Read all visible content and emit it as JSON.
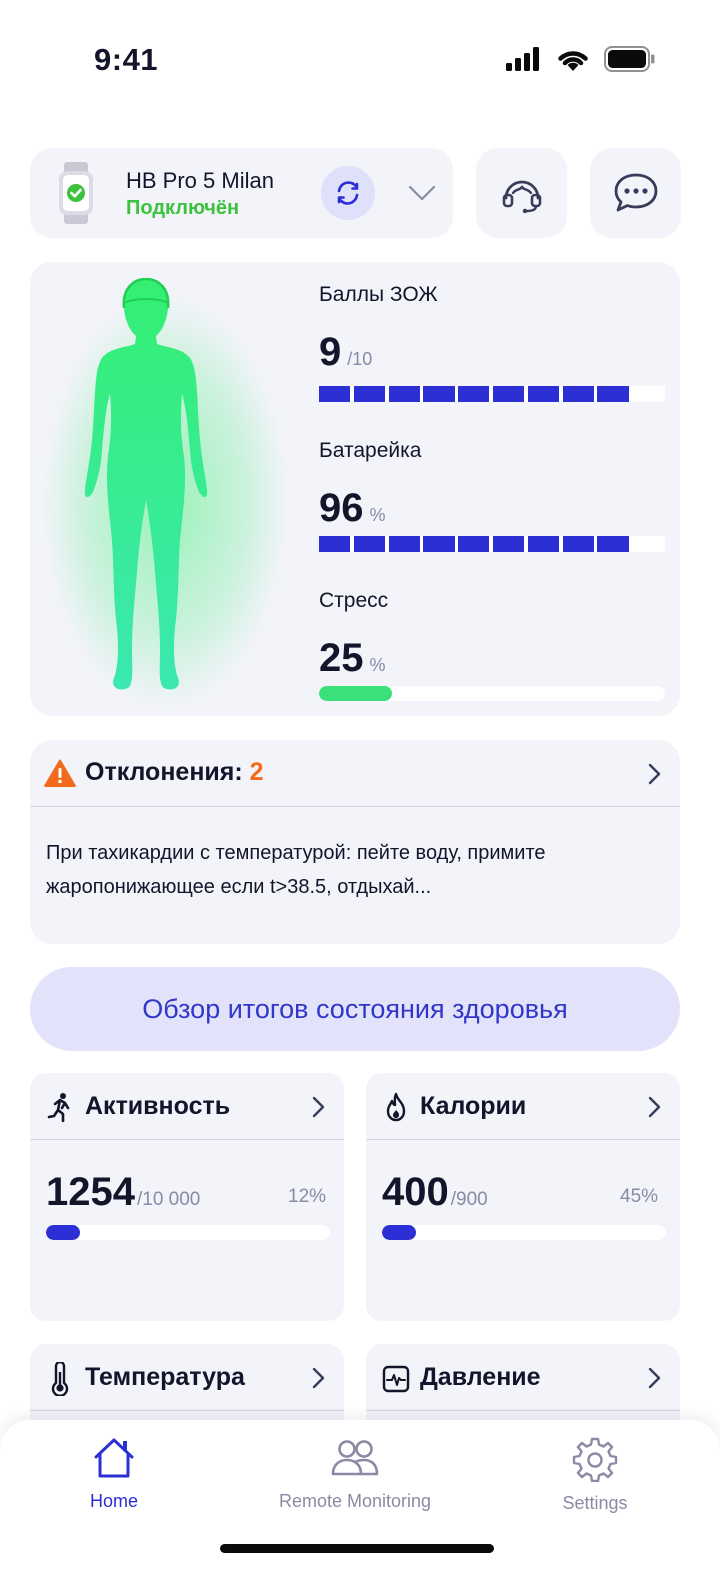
{
  "status_bar": {
    "time": "9:41"
  },
  "device": {
    "name": "HB Pro 5 Milan",
    "status": "Подключён"
  },
  "metrics": {
    "hls": {
      "label": "Баллы ЗОЖ",
      "value": "9",
      "unit": "/10",
      "filled_segments": 9,
      "total_segments": 10
    },
    "battery": {
      "label": "Батарейка",
      "value": "96",
      "unit": "%",
      "filled_segments": 9,
      "total_segments": 10
    },
    "stress": {
      "label": "Стресс",
      "value": "25",
      "unit": "%",
      "fill_percent": 21
    }
  },
  "deviations": {
    "title": "Отклонения:",
    "count": "2",
    "text": "При тахикардии с температурой: пейте воду, примите жаропонижающее если t>38.5, отдыхай..."
  },
  "overview_button": {
    "label": "Обзор итогов состояния здоровья"
  },
  "tiles": {
    "activity": {
      "title": "Активность",
      "value": "1254",
      "goal": "/10 000",
      "percent": "12%",
      "fill_percent": 12
    },
    "calories": {
      "title": "Калории",
      "value": "400",
      "goal": "/900",
      "percent": "45%",
      "fill_percent": 12
    },
    "temperature": {
      "title": "Температура"
    },
    "pressure": {
      "title": "Давление"
    }
  },
  "tabbar": {
    "home": "Home",
    "remote": "Remote Monitoring",
    "settings": "Settings"
  },
  "colors": {
    "accent": "#2c2fd4",
    "connected": "#3cc23c",
    "warning": "#f26b1d",
    "stress": "#3ae07a",
    "card": "#f3f3fa",
    "inactive_tab": "#8a8aa5"
  },
  "icons": [
    "watch-icon",
    "sync-icon",
    "chevron-down-icon",
    "support-headset-icon",
    "chat-icon",
    "warning-icon",
    "running-icon",
    "flame-icon",
    "thermometer-icon",
    "pulse-monitor-icon",
    "home-icon",
    "users-icon",
    "gear-icon",
    "chevron-right-icon"
  ]
}
